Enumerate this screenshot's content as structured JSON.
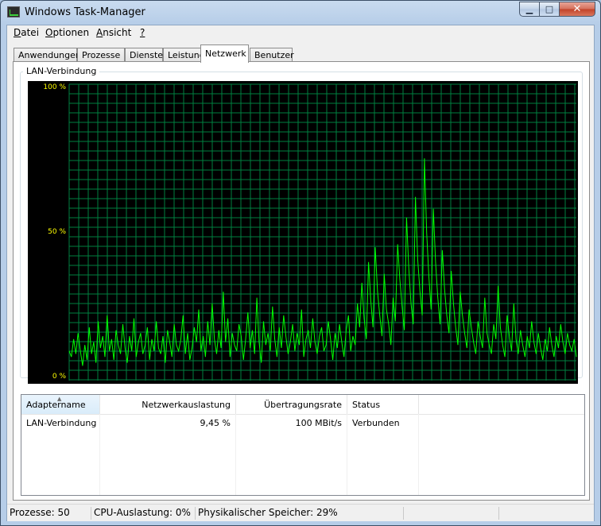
{
  "window": {
    "title": "Windows Task-Manager"
  },
  "menu": [
    {
      "label": "Datei",
      "access": "D",
      "rest": "atei"
    },
    {
      "label": "Optionen",
      "access": "O",
      "rest": "ptionen"
    },
    {
      "label": "Ansicht",
      "access": "A",
      "rest": "nsicht"
    },
    {
      "label": "?",
      "access": "?",
      "rest": ""
    }
  ],
  "tabs": [
    "Anwendungen",
    "Prozesse",
    "Dienste",
    "Leistung",
    "Netzwerk",
    "Benutzer"
  ],
  "active_tab": "Netzwerk",
  "graph": {
    "title": "LAN-Verbindung",
    "y_labels": [
      "100 %",
      "50 %",
      "0 %"
    ],
    "grid_color": "#008040",
    "line_color": "#00ff00",
    "label_color": "#ffff00"
  },
  "chart_data": {
    "type": "line",
    "ylim": [
      0,
      100
    ],
    "values": [
      10,
      8,
      14,
      9,
      16,
      10,
      5,
      12,
      7,
      18,
      9,
      13,
      6,
      20,
      11,
      15,
      8,
      22,
      10,
      14,
      7,
      17,
      12,
      9,
      19,
      11,
      6,
      15,
      10,
      21,
      8,
      13,
      16,
      9,
      12,
      18,
      7,
      14,
      10,
      20,
      11,
      9,
      15,
      6,
      17,
      13,
      8,
      19,
      12,
      10,
      14,
      22,
      9,
      16,
      7,
      11,
      18,
      13,
      24,
      10,
      15,
      8,
      20,
      12,
      26,
      14,
      9,
      17,
      11,
      30,
      13,
      21,
      8,
      16,
      12,
      10,
      19,
      15,
      7,
      14,
      23,
      11,
      17,
      9,
      28,
      13,
      6,
      20,
      12,
      16,
      10,
      25,
      14,
      8,
      18,
      11,
      22,
      15,
      9,
      13,
      19,
      10,
      16,
      12,
      24,
      8,
      14,
      17,
      11,
      21,
      13,
      9,
      15,
      18,
      10,
      12,
      20,
      14,
      7,
      16,
      11,
      19,
      13,
      8,
      17,
      22,
      10,
      15,
      12,
      26,
      18,
      33,
      21,
      14,
      40,
      27,
      18,
      45,
      30,
      22,
      15,
      36,
      24,
      19,
      12,
      28,
      20,
      46,
      34,
      25,
      17,
      55,
      38,
      26,
      19,
      62,
      41,
      30,
      22,
      75,
      50,
      35,
      24,
      58,
      40,
      28,
      19,
      44,
      31,
      22,
      16,
      37,
      26,
      18,
      12,
      30,
      22,
      16,
      11,
      24,
      18,
      13,
      9,
      20,
      15,
      11,
      28,
      16,
      12,
      9,
      19,
      14,
      32,
      18,
      12,
      8,
      22,
      15,
      10,
      26,
      14,
      9,
      17,
      12,
      8,
      15,
      11,
      20,
      13,
      9,
      16,
      11,
      7,
      14,
      10,
      18,
      12,
      8,
      15,
      11,
      19,
      13,
      9,
      16,
      12,
      10,
      14,
      8
    ]
  },
  "list": {
    "columns": [
      "Adaptername",
      "Netzwerkauslastung",
      "Übertragungsrate",
      "Status"
    ],
    "rows": [
      {
        "name": "LAN-Verbindung",
        "usage": "9,45 %",
        "rate": "100 MBit/s",
        "status": "Verbunden"
      }
    ]
  },
  "status": {
    "processes": "Prozesse: 50",
    "cpu": "CPU-Auslastung: 0%",
    "memory": "Physikalischer Speicher: 29%"
  }
}
